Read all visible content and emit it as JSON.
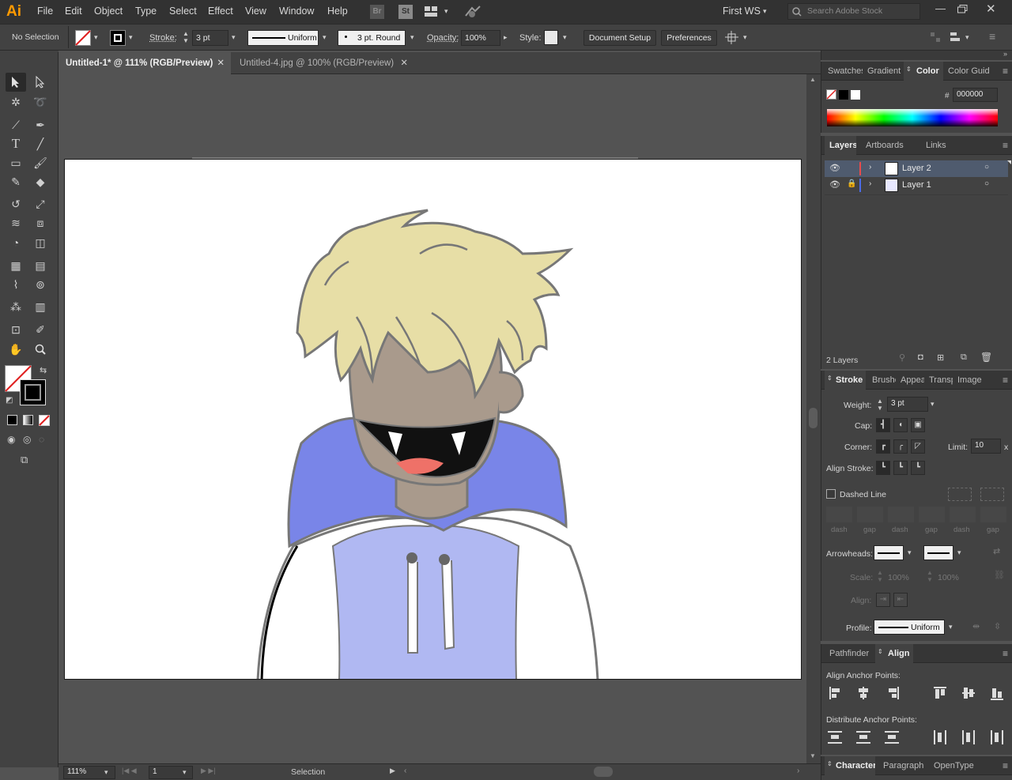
{
  "app": {
    "logo": "Ai"
  },
  "menu": [
    "File",
    "Edit",
    "Object",
    "Type",
    "Select",
    "Effect",
    "View",
    "Window",
    "Help"
  ],
  "appbar": {
    "br": "Br",
    "st": "St",
    "workspace": "First WS",
    "search_placeholder": "Search Adobe Stock"
  },
  "control": {
    "selection": "No Selection",
    "stroke_label": "Stroke:",
    "stroke_value": "3 pt",
    "profile": "Uniform",
    "brush": "3 pt. Round",
    "opacity_label": "Opacity:",
    "opacity_value": "100%",
    "style_label": "Style:",
    "doc_setup": "Document Setup",
    "preferences": "Preferences"
  },
  "tabs": [
    {
      "label": "Untitled-1* @ 111% (RGB/Preview)",
      "active": true
    },
    {
      "label": "Untitled-4.jpg @ 100% (RGB/Preview)",
      "active": false
    }
  ],
  "status": {
    "zoom": "111%",
    "page": "1",
    "tool": "Selection"
  },
  "color_panel": {
    "tabs": [
      "Swatches",
      "Gradient",
      "Color",
      "Color Guide"
    ],
    "hex_label": "#",
    "hex": "000000"
  },
  "layers_panel": {
    "tabs": [
      "Layers",
      "Artboards",
      "Links"
    ],
    "layers": [
      {
        "name": "Layer 2",
        "color": "#e84c4c",
        "selected": true
      },
      {
        "name": "Layer 1",
        "color": "#4c6ce8",
        "selected": false
      }
    ],
    "count": "2 Layers"
  },
  "stroke_panel": {
    "tabs": [
      "Stroke",
      "Brushes",
      "Appearance",
      "Transparency",
      "Image Trace"
    ],
    "weight_label": "Weight:",
    "weight": "3 pt",
    "cap_label": "Cap:",
    "corner_label": "Corner:",
    "limit_label": "Limit:",
    "limit": "10",
    "limit_unit": "x",
    "align_label": "Align Stroke:",
    "dashed": "Dashed Line",
    "dash_labels": [
      "dash",
      "gap",
      "dash",
      "gap",
      "dash",
      "gap"
    ],
    "arrowheads_label": "Arrowheads:",
    "scale_label": "Scale:",
    "scale1": "100%",
    "scale2": "100%",
    "align2_label": "Align:",
    "profile_label": "Profile:",
    "profile": "Uniform"
  },
  "align_panel": {
    "tabs": [
      "Pathfinder",
      "Align"
    ],
    "anchor_label": "Align Anchor Points:",
    "distribute_label": "Distribute Anchor Points:"
  },
  "char_panel": {
    "tabs": [
      "Character",
      "Paragraph",
      "OpenType"
    ]
  }
}
